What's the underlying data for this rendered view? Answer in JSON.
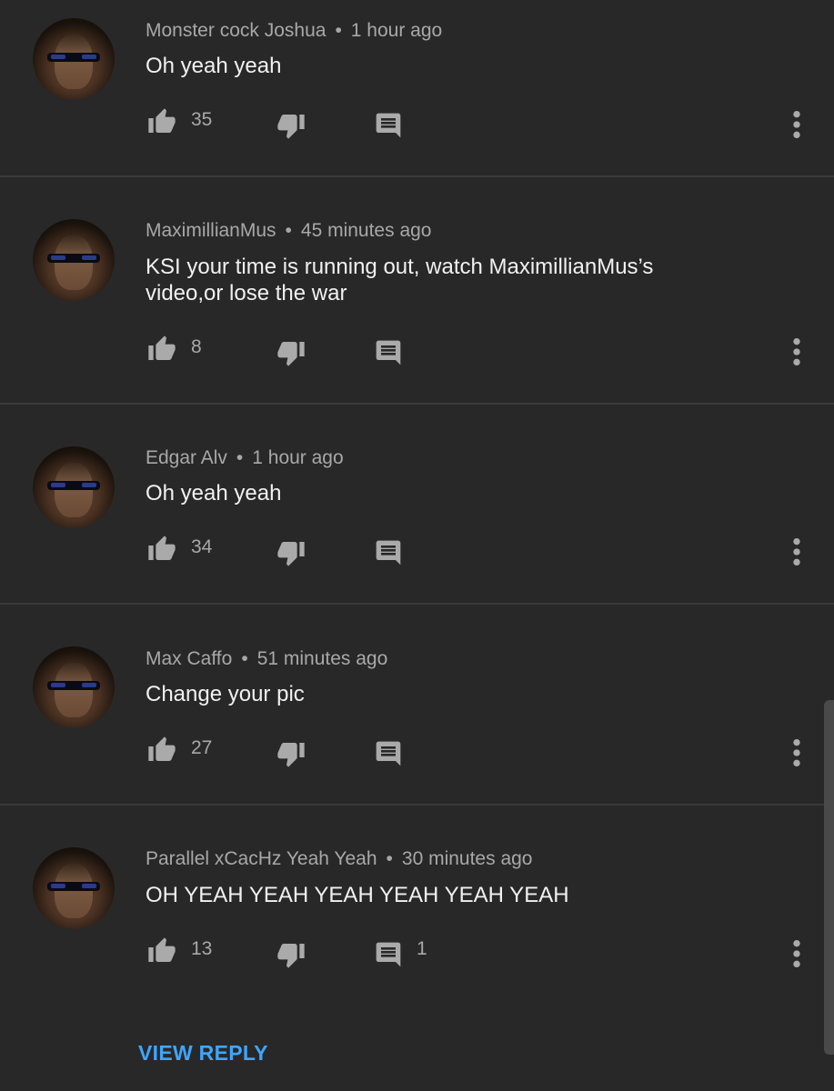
{
  "comments": [
    {
      "author": "Monster cock Joshua",
      "time": "1 hour ago",
      "text": "Oh yeah yeah",
      "likes": "35",
      "replies": ""
    },
    {
      "author": "MaximillianMus",
      "time": "45 minutes ago",
      "text": "KSI your time is running out, watch MaximillianMus’s video,or lose the war",
      "likes": "8",
      "replies": ""
    },
    {
      "author": "Edgar Alv",
      "time": "1 hour ago",
      "text": "Oh yeah yeah",
      "likes": "34",
      "replies": ""
    },
    {
      "author": "Max Caffo",
      "time": "51 minutes ago",
      "text": "Change your pic",
      "likes": "27",
      "replies": ""
    },
    {
      "author": "Parallel xCacHz Yeah Yeah",
      "time": "30 minutes ago",
      "text": "OH YEAH YEAH YEAH YEAH YEAH YEAH",
      "likes": "13",
      "replies": "1"
    }
  ],
  "separator": "•",
  "view_reply_label": "VIEW REPLY",
  "icons": {
    "like": "thumbs-up-icon",
    "dislike": "thumbs-down-icon",
    "reply": "comment-icon",
    "more": "more-vertical-icon"
  },
  "colors": {
    "background": "#282828",
    "text": "#f1f1f1",
    "meta": "#a8a8a8",
    "link": "#3ea6ff"
  }
}
